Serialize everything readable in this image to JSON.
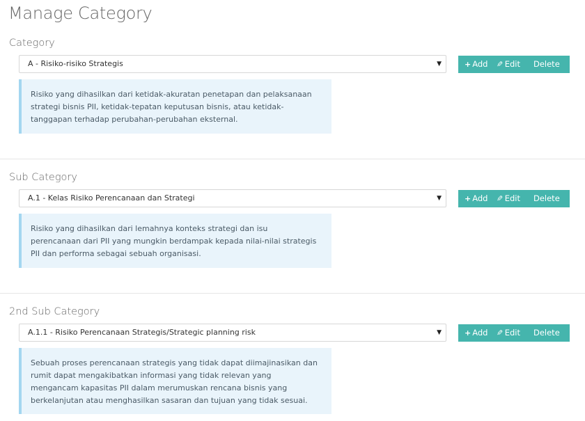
{
  "page": {
    "title": "Manage Category"
  },
  "actions": {
    "add_label": "Add",
    "edit_label": "Edit",
    "delete_label": "Delete"
  },
  "sections": [
    {
      "label": "Category",
      "selected": "A - Risiko-risiko Strategis",
      "description": "Risiko yang dihasilkan dari ketidak-akuratan penetapan dan pelaksanaan strategi bisnis PII, ketidak-tepatan keputusan bisnis, atau ketidak-tanggapan terhadap perubahan-perubahan eksternal."
    },
    {
      "label": "Sub Category",
      "selected": "A.1 - Kelas Risiko Perencanaan dan Strategi",
      "description": "Risiko yang dihasilkan dari lemahnya konteks strategi dan isu perencanaan dari PII yang mungkin berdampak kepada nilai-nilai strategis PII dan performa sebagai sebuah organisasi."
    },
    {
      "label": "2nd Sub Category",
      "selected": "A.1.1 - Risiko Perencanaan Strategis/Strategic planning risk",
      "description": "Sebuah proses perencanaan strategis yang tidak dapat diimajinasikan dan rumit dapat mengakibatkan informasi yang tidak relevan yang mengancam kapasitas PII dalam merumuskan rencana bisnis yang berkelanjutan atau menghasilkan sasaran dan tujuan yang tidak sesuai."
    }
  ]
}
